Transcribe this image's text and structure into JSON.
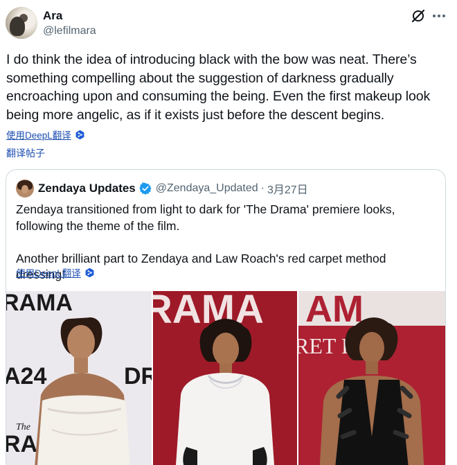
{
  "post": {
    "author_name": "Ara",
    "author_handle": "@lefilmara",
    "text": "I do think the idea of introducing black with the bow was neat. There’s something compelling about the suggestion of darkness gradually encroaching upon and consuming the being. Even the first makeup look being more angelic, as if it exists just before the descent begins.",
    "translate_label": "使用DeepL翻译",
    "translate_post_label": "翻译帖子",
    "grok_icon": "grok-icon",
    "more_icon": "more-options-icon"
  },
  "quote": {
    "author_name": "Zendaya Updates",
    "author_handle": "@Zendaya_Updated",
    "separator": "·",
    "date": "3月27日",
    "text_line1": "Zendaya transitioned from light to dark for 'The Drama' premiere looks, following the theme of the film.",
    "text_line2": "Another brilliant part to Zendaya and Law Roach's red carpet method dressing!",
    "translate_label": "使用DeepL翻译",
    "verified_color": "#1d9bf0"
  },
  "photos": {
    "photo1_backdrop_text_top": "RAMA",
    "photo1_backdrop_text_mid": "A24",
    "photo1_backdrop_text_right": "DR",
    "photo1_backdrop_text_bottom_small": "The",
    "photo1_backdrop_text_bottom": "RAMA",
    "photo2_backdrop_text": "RAMA",
    "photo3_backdrop_text_top": "AM",
    "photo3_backdrop_text_mid": "RET  PER"
  },
  "colors": {
    "link": "#1d4fb0",
    "handle": "#536471",
    "text": "#0f1419",
    "deepl_blue": "#1e5bd6"
  }
}
